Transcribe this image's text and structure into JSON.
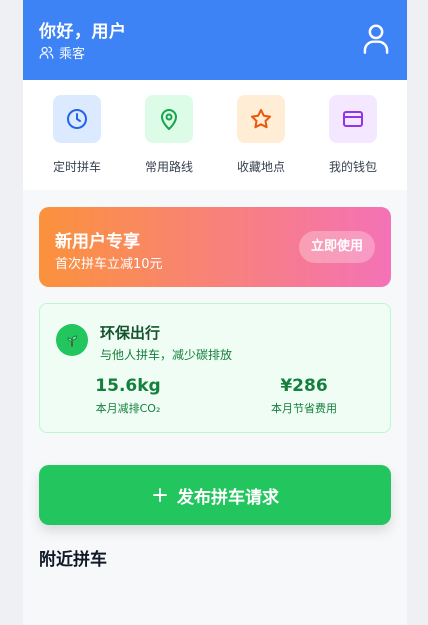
{
  "header": {
    "greeting": "你好，用户",
    "role": "乘客"
  },
  "quick_actions": [
    {
      "label": "定时拼车",
      "icon": "clock-icon"
    },
    {
      "label": "常用路线",
      "icon": "map-pin-icon"
    },
    {
      "label": "收藏地点",
      "icon": "star-icon"
    },
    {
      "label": "我的钱包",
      "icon": "wallet-icon"
    }
  ],
  "promo": {
    "title": "新用户专享",
    "subtitle": "首次拼车立减10元",
    "button": "立即使用"
  },
  "eco": {
    "title": "环保出行",
    "subtitle": "与他人拼车，减少碳排放",
    "co2_value": "15.6kg",
    "co2_label": "本月减排CO₂",
    "saving_value": "¥286",
    "saving_label": "本月节省费用"
  },
  "publish_button": "发布拼车请求",
  "nearby_title": "附近拼车",
  "colors": {
    "primary": "#3d83f6",
    "green": "#22c55e",
    "promo_start": "#fb923c",
    "promo_end": "#f472b6"
  }
}
